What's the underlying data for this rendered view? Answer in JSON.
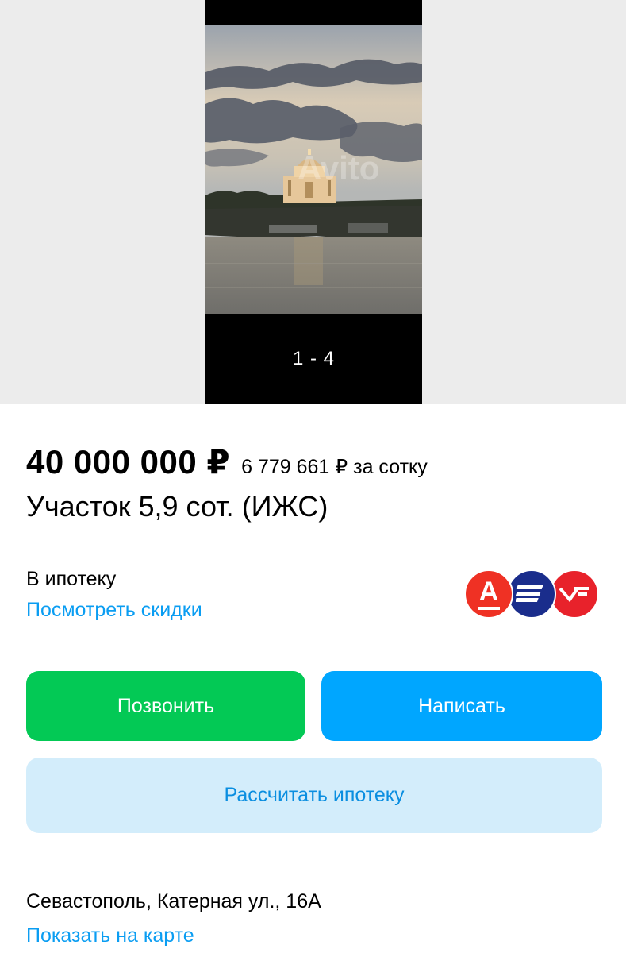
{
  "gallery": {
    "counter": "1 - 4",
    "watermark": "Avito"
  },
  "listing": {
    "price": "40 000 000 ₽",
    "price_per_unit": "6 779 661 ₽ за сотку",
    "title": "Участок 5,9 сот. (ИЖС)"
  },
  "mortgage": {
    "label": "В ипотеку",
    "discounts_link": "Посмотреть скидки",
    "banks": [
      {
        "name": "alfa-bank-logo",
        "letter": "А",
        "color": "#ef3124"
      },
      {
        "name": "otkritie-bank-logo",
        "color": "#1a2d8c"
      },
      {
        "name": "pochta-bank-logo",
        "color": "#e8222b"
      }
    ]
  },
  "actions": {
    "call_label": "Позвонить",
    "write_label": "Написать",
    "calc_mortgage_label": "Рассчитать ипотеку",
    "call_color": "#03c955",
    "write_color": "#00a6ff",
    "calc_color": "#d3edfb"
  },
  "location": {
    "address": "Севастополь, Катерная ул., 16А",
    "map_link": "Показать на карте"
  }
}
